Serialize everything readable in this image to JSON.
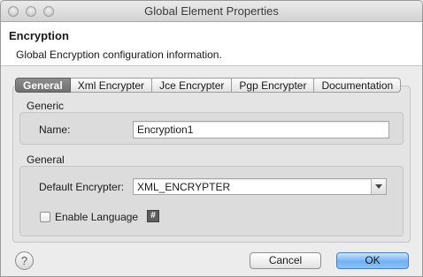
{
  "window": {
    "title": "Global Element Properties"
  },
  "header": {
    "title": "Encryption",
    "description": "Global Encryption configuration information."
  },
  "tabs": [
    {
      "label": "General",
      "active": true
    },
    {
      "label": "Xml Encrypter",
      "active": false
    },
    {
      "label": "Jce Encrypter",
      "active": false
    },
    {
      "label": "Pgp Encrypter",
      "active": false
    },
    {
      "label": "Documentation",
      "active": false
    }
  ],
  "generic_group": {
    "label": "Generic",
    "name_label": "Name:",
    "name_value": "Encryption1"
  },
  "general_group": {
    "label": "General",
    "encrypter_label": "Default Encrypter:",
    "encrypter_value": "XML_ENCRYPTER",
    "enable_language_label": "Enable Language",
    "enable_language_checked": false,
    "hash_button_glyph": "#"
  },
  "footer": {
    "help_glyph": "?",
    "cancel_label": "Cancel",
    "ok_label": "OK"
  }
}
